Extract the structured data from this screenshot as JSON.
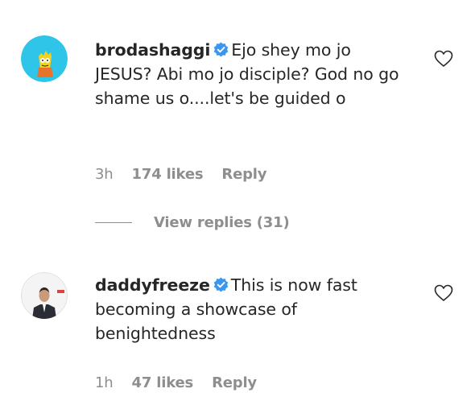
{
  "comments": [
    {
      "username": "brodashaggi",
      "text": "Ejo shey mo jo JESUS? Abi mo jo disciple? God no go shame us o....let's be guided o",
      "time": "3h",
      "likes": "174 likes",
      "reply_label": "Reply",
      "view_replies": "View replies (31)"
    },
    {
      "username": "daddyfreeze",
      "text": "This is now fast becoming a showcase of benightedness",
      "time": "1h",
      "likes": "47 likes",
      "reply_label": "Reply"
    }
  ],
  "icons": {
    "verified": "verified-badge-icon",
    "like": "heart-outline-icon",
    "verified_color": "#3897f0"
  }
}
